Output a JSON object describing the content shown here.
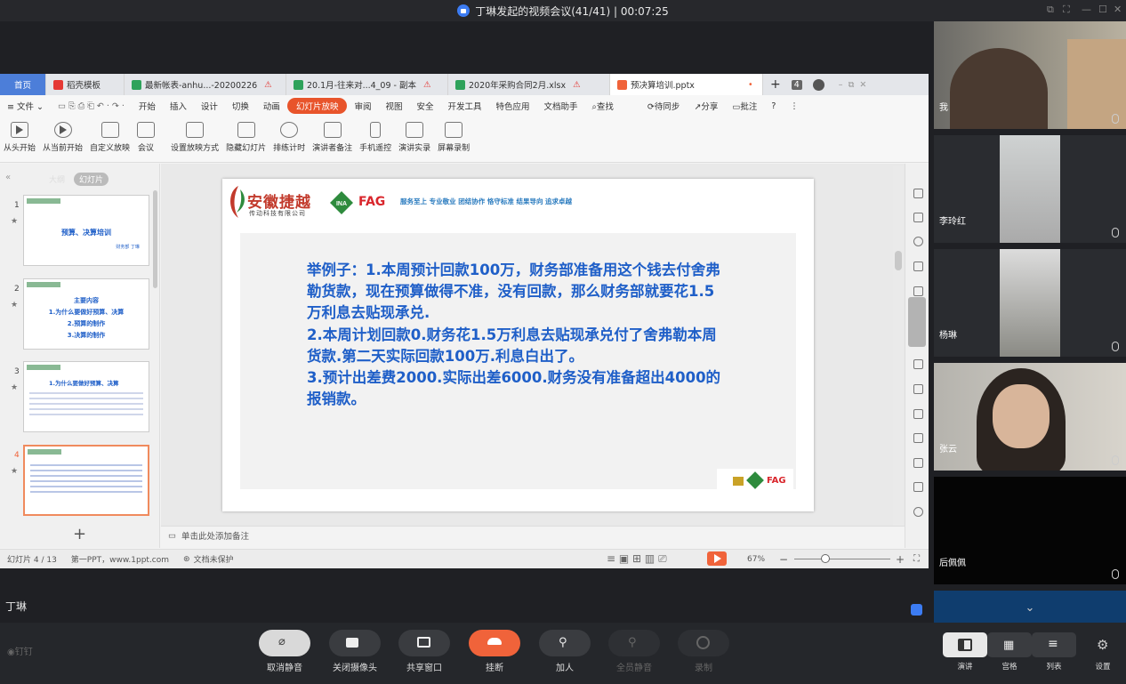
{
  "meeting": {
    "title": "丁琳发起的视频会议(41/41) | 00:07:25",
    "presenter": "丁琳"
  },
  "wps": {
    "tabs": [
      {
        "label": "首页",
        "kind": "home"
      },
      {
        "label": "稻壳模板",
        "kind": "docer"
      },
      {
        "label": "最新帐表-anhu...-20200226",
        "kind": "sheet",
        "warn": "⚠"
      },
      {
        "label": "20.1月-往来对...4_09 - 副本",
        "kind": "sheet",
        "warn": "⚠"
      },
      {
        "label": "2020年采购合同2月.xlsx",
        "kind": "sheet",
        "warn": "⚠"
      },
      {
        "label": "预决算培训.pptx",
        "kind": "ppt",
        "warn": "•"
      }
    ],
    "tab_count": "4",
    "menu": [
      "文件",
      "开始",
      "插入",
      "设计",
      "切换",
      "动画",
      "幻灯片放映",
      "审阅",
      "视图",
      "安全",
      "开发工具",
      "特色应用",
      "文档助手",
      "查找"
    ],
    "menu_active": "幻灯片放映",
    "menu_right": [
      "待同步",
      "分享",
      "批注"
    ],
    "ribbon": [
      "从头开始",
      "从当前开始",
      "自定义放映",
      "会议",
      "设置放映方式",
      "隐藏幻灯片",
      "排练计时",
      "演讲者备注",
      "手机遥控",
      "演讲实录",
      "屏幕录制"
    ],
    "panel_tabs": [
      "大纲",
      "幻灯片"
    ],
    "thumbs": [
      {
        "num": "1",
        "title": "预算、决算培训",
        "sub": "财务部 丁琳"
      },
      {
        "num": "2",
        "title": "主要内容",
        "lines": [
          "1.为什么要做好预算、决算",
          "2.预算的制作",
          "3.决算的制作"
        ]
      },
      {
        "num": "3",
        "title": "1.为什么要做好预算、决算"
      },
      {
        "num": "4",
        "title": ""
      }
    ],
    "slide": {
      "company": "安徽捷越",
      "company_sub": "传动科技有限公司",
      "brand": "FAG",
      "brand2": "INA",
      "slogan": "服务至上  专业敬业  团结协作  恪守标准  结果导向  追求卓越",
      "text": "举例子：1.本周预计回款100万，财务部准备用这个钱去付舍弗勒货款，现在预算做得不准，没有回款，那么财务部就要花1.5万利息去贴现承兑.\n2.本周计划回款0.财务花1.5万利息去贴现承兑付了舍弗勒本周货款.第二天实际回款100万.利息白出了。\n3.预计出差费2000.实际出差6000.财务没有准备超出4000的报销款。",
      "footer_brand": "FAG"
    },
    "notes_placeholder": "单击此处添加备注",
    "status": {
      "slide": "幻灯片 4 / 13",
      "theme": "第一PPT，www.1ppt.com",
      "protect": "文档未保护",
      "zoom": "67%"
    }
  },
  "participants": [
    {
      "name": "我",
      "tile": "webcam"
    },
    {
      "name": "李玲红",
      "tile": "portrait"
    },
    {
      "name": "杨琳",
      "tile": "portrait"
    },
    {
      "name": "张云",
      "tile": "webcam"
    },
    {
      "name": "后佩佩",
      "tile": "black"
    }
  ],
  "controls": [
    {
      "label": "取消静音",
      "icon": "mic-muted-icon"
    },
    {
      "label": "关闭摄像头",
      "icon": "camera-icon"
    },
    {
      "label": "共享窗口",
      "icon": "screen-share-icon"
    },
    {
      "label": "挂断",
      "icon": "hangup-icon"
    },
    {
      "label": "加人",
      "icon": "add-person-icon"
    },
    {
      "label": "全员静音",
      "icon": "mute-all-icon"
    },
    {
      "label": "录制",
      "icon": "record-icon"
    }
  ],
  "layout_modes": [
    "演讲",
    "宫格",
    "列表",
    "设置"
  ],
  "app_logo": "钉钉",
  "colors": {
    "accent": "#f0633a",
    "slide_text": "#1f5fc8",
    "hangup": "#f0633a",
    "wps_active_menu": "#e8542b"
  }
}
